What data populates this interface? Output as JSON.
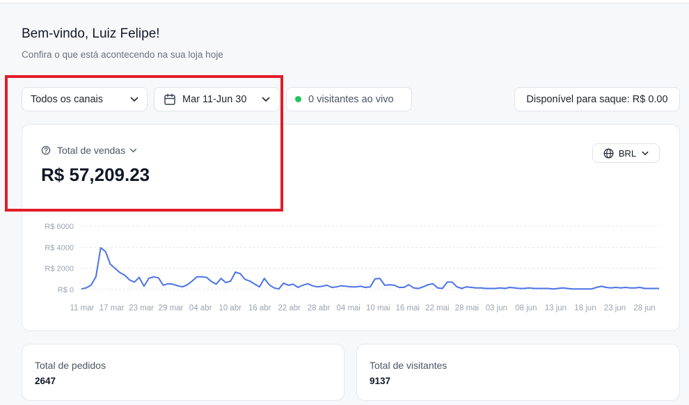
{
  "header": {
    "greeting": "Bem-vindo, Luiz Felipe!",
    "subtitle": "Confira o que está acontecendo na sua loja hoje"
  },
  "filters": {
    "channel": "Todos os canais",
    "date_range": "Mar 11-Jun 30",
    "live_visitors": "0 visitantes ao vivo",
    "balance": "Disponível para saque: R$ 0.00"
  },
  "sales": {
    "label": "Total de vendas",
    "value": "R$ 57,209.23",
    "currency": "BRL"
  },
  "stats": {
    "orders_label": "Total de pedidos",
    "orders_value": "2647",
    "visitors_label": "Total de visitantes",
    "visitors_value": "9137"
  },
  "colors": {
    "line": "#4a72e8",
    "live_dot": "#22c55e",
    "highlight": "#e11d27"
  },
  "icons": [
    "chevron-down-icon",
    "calendar-icon",
    "help-circle-icon",
    "globe-icon"
  ],
  "chart_data": {
    "type": "line",
    "title": "",
    "xlabel": "",
    "ylabel": "",
    "ylim": [
      0,
      6000
    ],
    "yticks": [
      "R$ 6000",
      "R$ 4000",
      "R$ 2000",
      "R$ 0"
    ],
    "yticks_values": [
      6000,
      4000,
      2000,
      0
    ],
    "x_tick_labels": [
      "11 mar",
      "17 mar",
      "23 mar",
      "29 mar",
      "04 abr",
      "10 abr",
      "16 abr",
      "22 abr",
      "28 abr",
      "04 mai",
      "10 mai",
      "16 mai",
      "22 mai",
      "28 mai",
      "03 jun",
      "08 jun",
      "13 jun",
      "18 jun",
      "23 jun",
      "28 jun"
    ],
    "grid": true,
    "series": [
      {
        "values": [
          50,
          150,
          400,
          1200,
          3950,
          3600,
          2400,
          2000,
          1600,
          1350,
          900,
          700,
          1150,
          300,
          1050,
          1200,
          1100,
          400,
          550,
          500,
          350,
          250,
          450,
          800,
          1200,
          1200,
          1150,
          750,
          500,
          1050,
          650,
          800,
          1650,
          1500,
          950,
          800,
          500,
          250,
          1050,
          450,
          150,
          50,
          600,
          400,
          500,
          200,
          400,
          550,
          350,
          250,
          300,
          400,
          200,
          250,
          350,
          300,
          250,
          250,
          300,
          200,
          250,
          1000,
          1050,
          400,
          450,
          400,
          200,
          200,
          450,
          150,
          100,
          250,
          450,
          550,
          150,
          100,
          700,
          700,
          250,
          100,
          250,
          200,
          150,
          150,
          100,
          100,
          100,
          150,
          100,
          200,
          150,
          100,
          100,
          150,
          100,
          100,
          100,
          100,
          50,
          100,
          150,
          100,
          50,
          50,
          50,
          50,
          50,
          200,
          300,
          200,
          150,
          200,
          150,
          200,
          150,
          150,
          200,
          100,
          100,
          100,
          100
        ]
      }
    ]
  }
}
